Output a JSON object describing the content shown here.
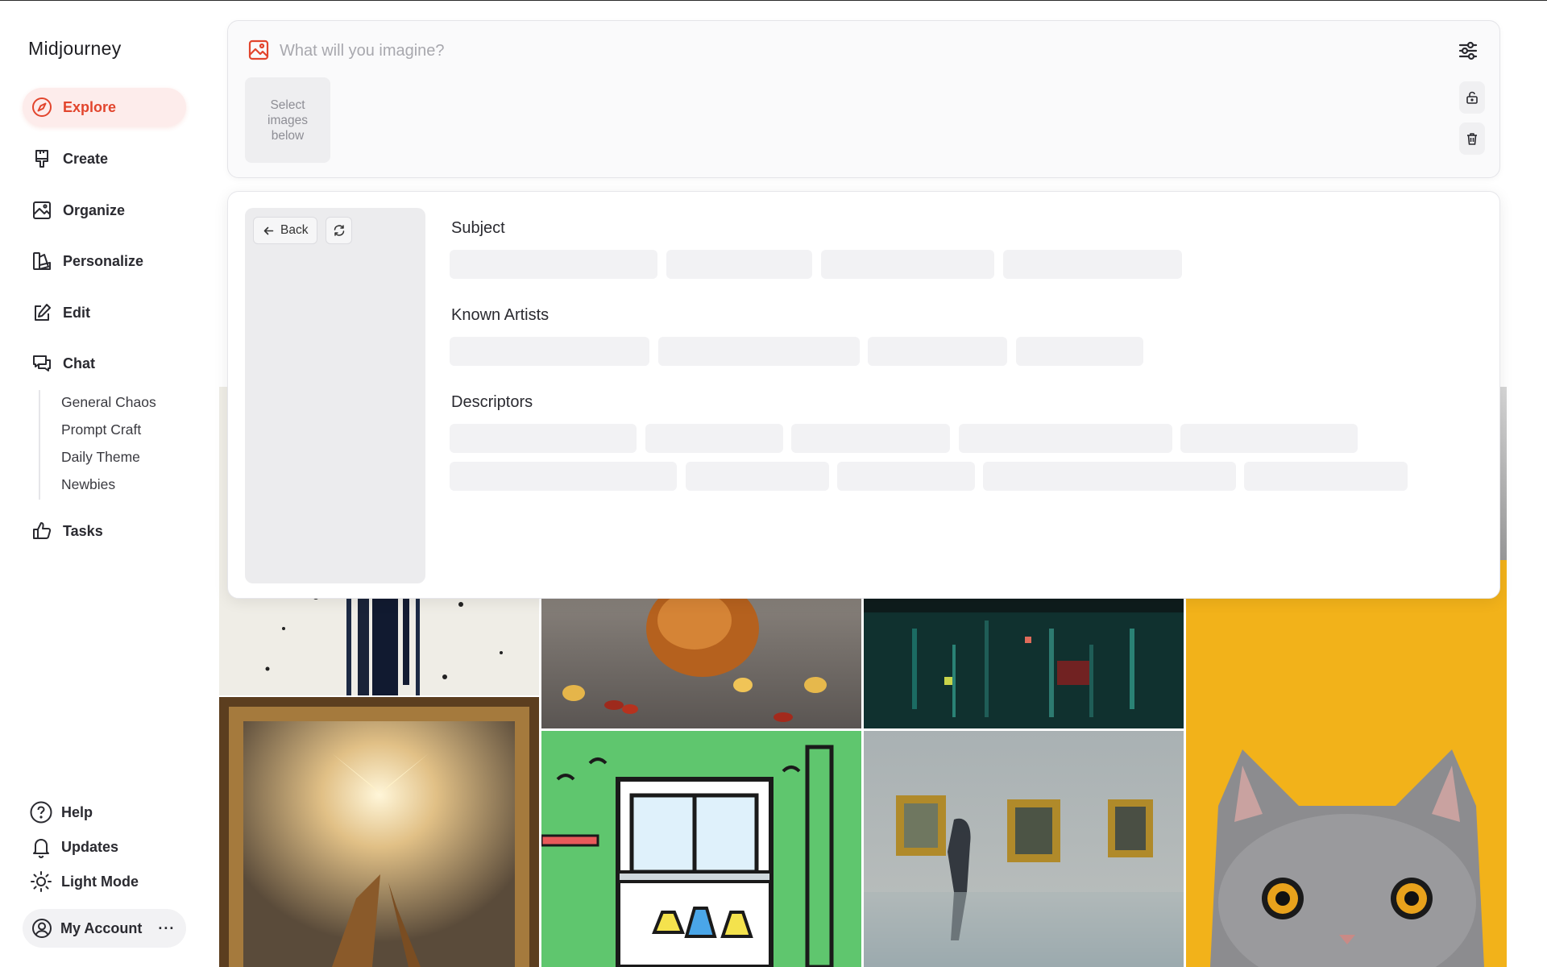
{
  "app": {
    "name": "Midjourney"
  },
  "nav": {
    "items": [
      {
        "label": "Explore",
        "icon": "compass-icon",
        "active": true
      },
      {
        "label": "Create",
        "icon": "paintbrush-icon"
      },
      {
        "label": "Organize",
        "icon": "image-icon"
      },
      {
        "label": "Personalize",
        "icon": "palette-icon"
      },
      {
        "label": "Edit",
        "icon": "edit-icon"
      },
      {
        "label": "Chat",
        "icon": "chat-icon"
      },
      {
        "label": "Tasks",
        "icon": "thumbs-up-icon"
      }
    ],
    "chat_rooms": [
      "General Chaos",
      "Prompt Craft",
      "Daily Theme",
      "Newbies"
    ]
  },
  "footer": {
    "help": "Help",
    "updates": "Updates",
    "light_mode": "Light Mode",
    "account": "My Account",
    "more": "···"
  },
  "prompt": {
    "placeholder": "What will you imagine?",
    "select_images": "Select images below"
  },
  "describe": {
    "back_label": "Back",
    "sections": [
      "Subject",
      "Known Artists",
      "Descriptors"
    ]
  },
  "colors": {
    "accent": "#e2452d",
    "accent_bg": "#fdeceb",
    "skeleton": "#f2f2f4",
    "panel_gray": "#ececee"
  },
  "gallery": {
    "tiles": [
      "ink-splatter-art",
      "fried-food-closeup",
      "neon-city-night",
      "angel-fresco-painting",
      "cartoon-window-potions",
      "gallery-walker-blur",
      "grey-cat-yellow-background"
    ]
  }
}
